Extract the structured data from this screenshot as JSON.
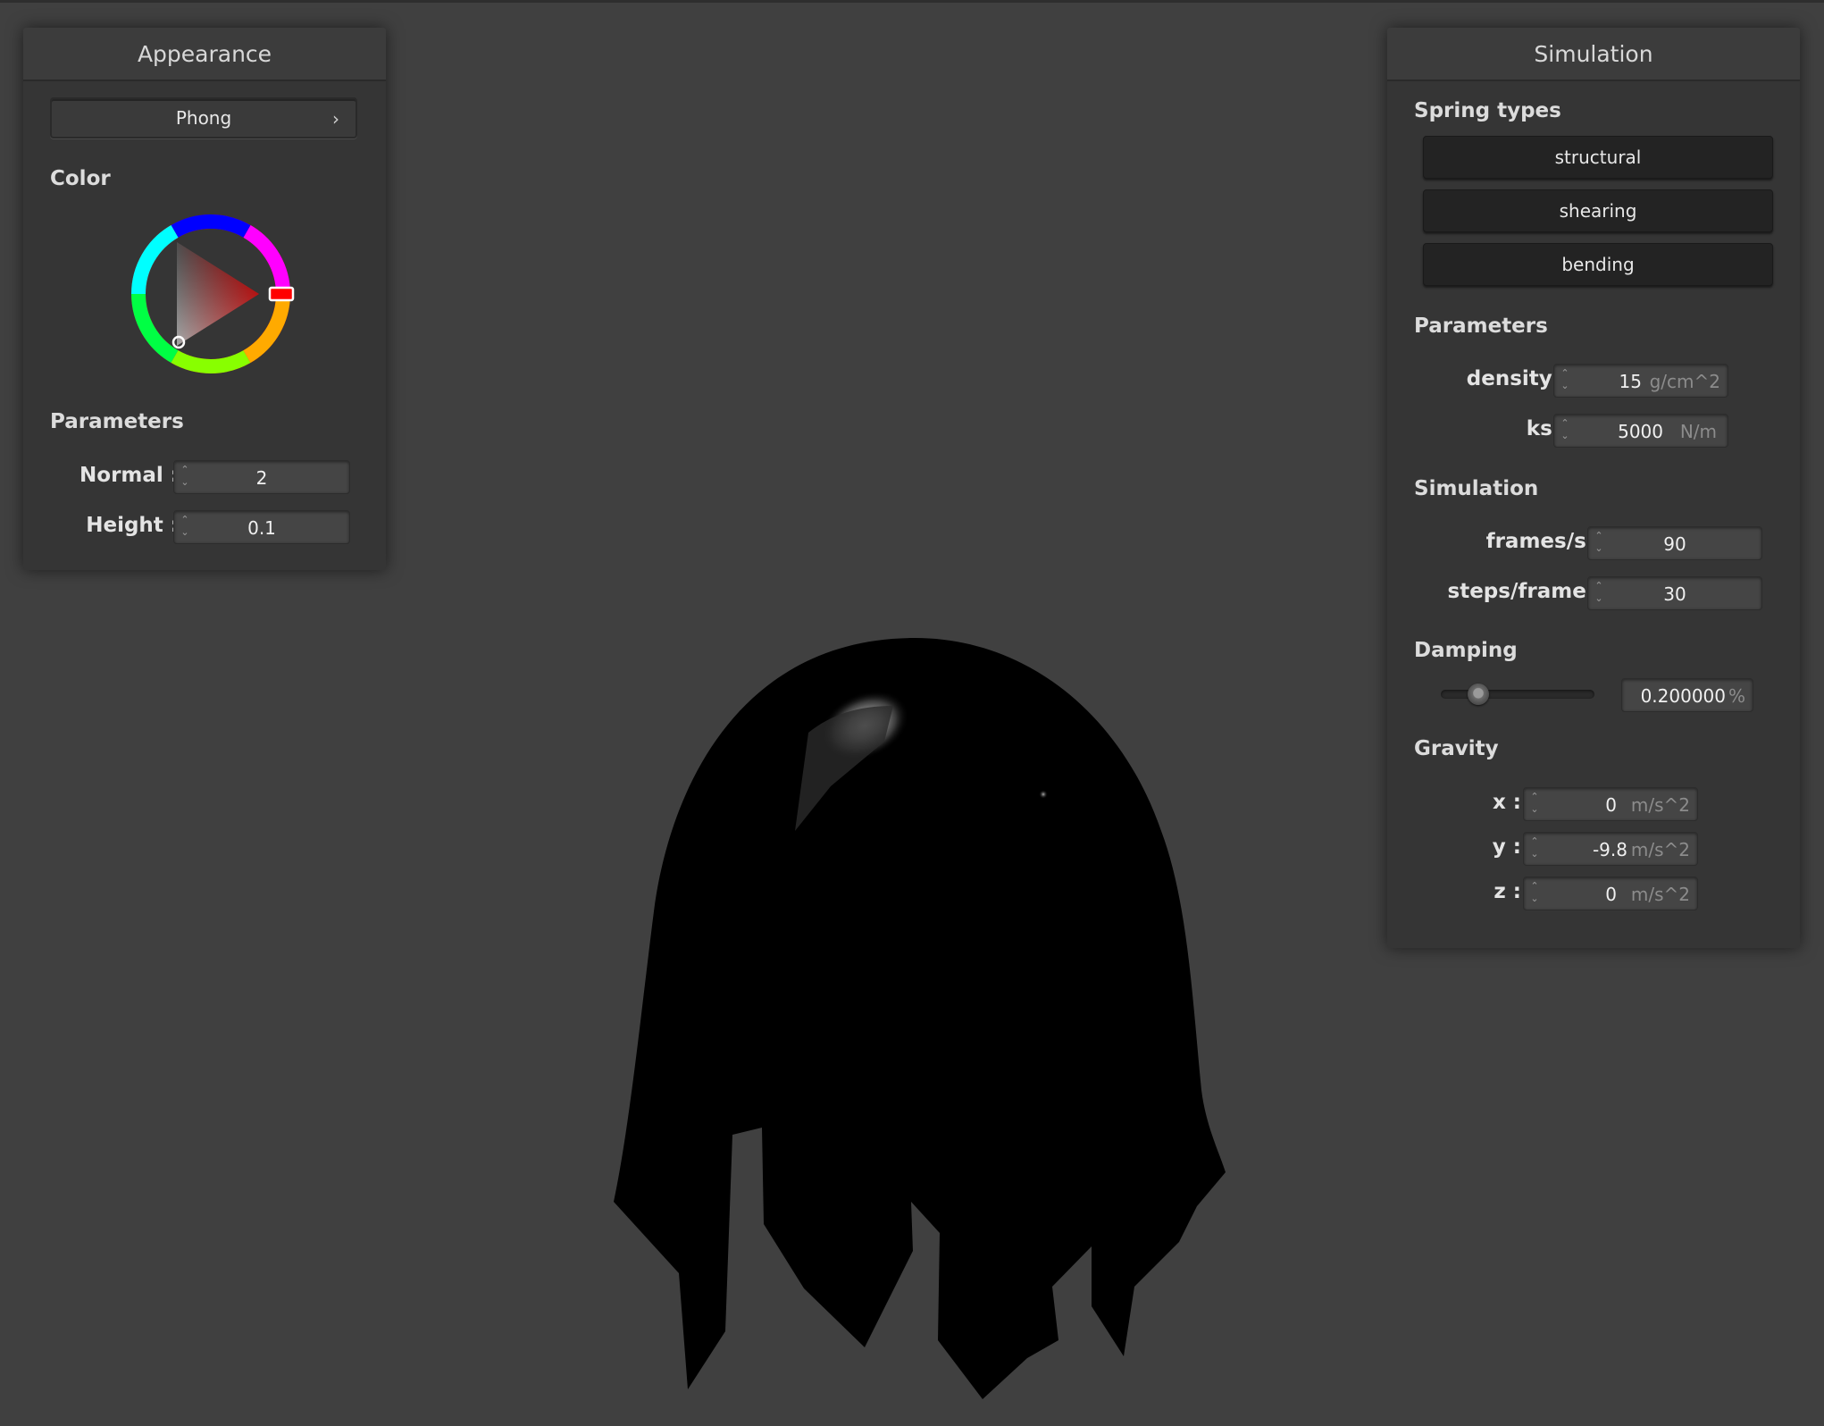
{
  "appearance": {
    "title": "Appearance",
    "shading": "Phong",
    "color_label": "Color",
    "color_hue": "#ff0000",
    "parameters_label": "Parameters",
    "normal_label": "Normal :",
    "normal_value": "2",
    "height_label": "Height :",
    "height_value": "0.1"
  },
  "simulation_panel": {
    "title": "Simulation",
    "spring_types_label": "Spring types",
    "spring_types": [
      "structural",
      "shearing",
      "bending"
    ],
    "parameters_label": "Parameters",
    "density_label": "density :",
    "density_value": "15",
    "density_unit": "g/cm^2",
    "ks_label": "ks :",
    "ks_value": "5000",
    "ks_unit": "N/m",
    "simulation_label": "Simulation",
    "fps_label": "frames/s :",
    "fps_value": "90",
    "steps_label": "steps/frame :",
    "steps_value": "30",
    "damping_label": "Damping",
    "damping_value": "0.200000",
    "damping_unit": "%",
    "damping_fraction": 0.2,
    "gravity_label": "Gravity",
    "gx_label": "x :",
    "gx_value": "0",
    "gy_label": "y :",
    "gy_value": "-9.8",
    "gz_label": "z :",
    "gz_value": "0",
    "gravity_unit": "m/s^2"
  }
}
